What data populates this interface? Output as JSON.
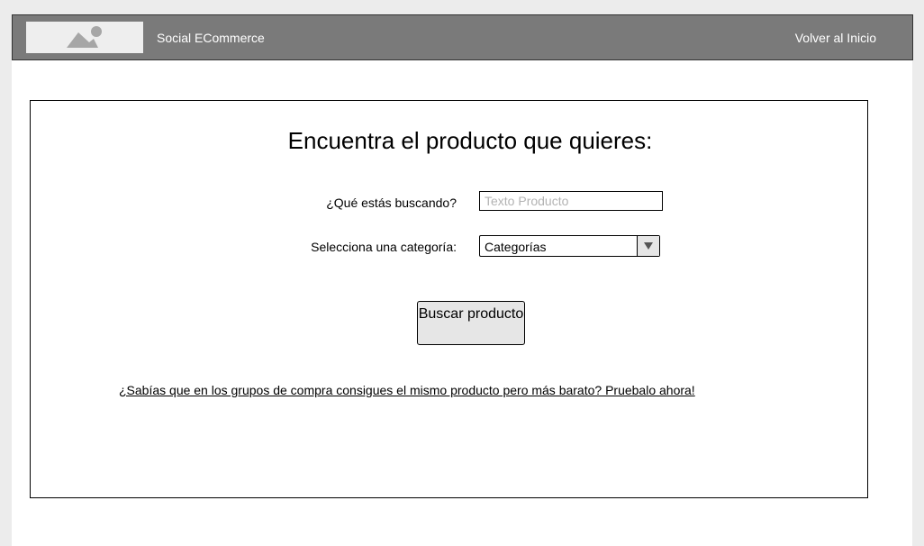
{
  "header": {
    "brand": "Social ECommerce",
    "home_link": "Volver al Inicio",
    "logo_icon": "image-placeholder-icon"
  },
  "search": {
    "title": "Encuentra el producto que quieres:",
    "query_label": "¿Qué estás buscando?",
    "query_placeholder": "Texto Producto",
    "query_value": "",
    "category_label": "Selecciona una categoría:",
    "category_value": "Categorías",
    "category_icon": "triangle-down-icon",
    "button_label": "Buscar producto",
    "promo_link": "¿Sabías que en los grupos de compra consigues el mismo producto pero más barato? Pruebalo ahora!"
  },
  "colors": {
    "header_bg": "#7a7a7a",
    "page_bg": "#ececec",
    "button_bg": "#e6e6e6",
    "placeholder_text": "#b3b3b3"
  }
}
